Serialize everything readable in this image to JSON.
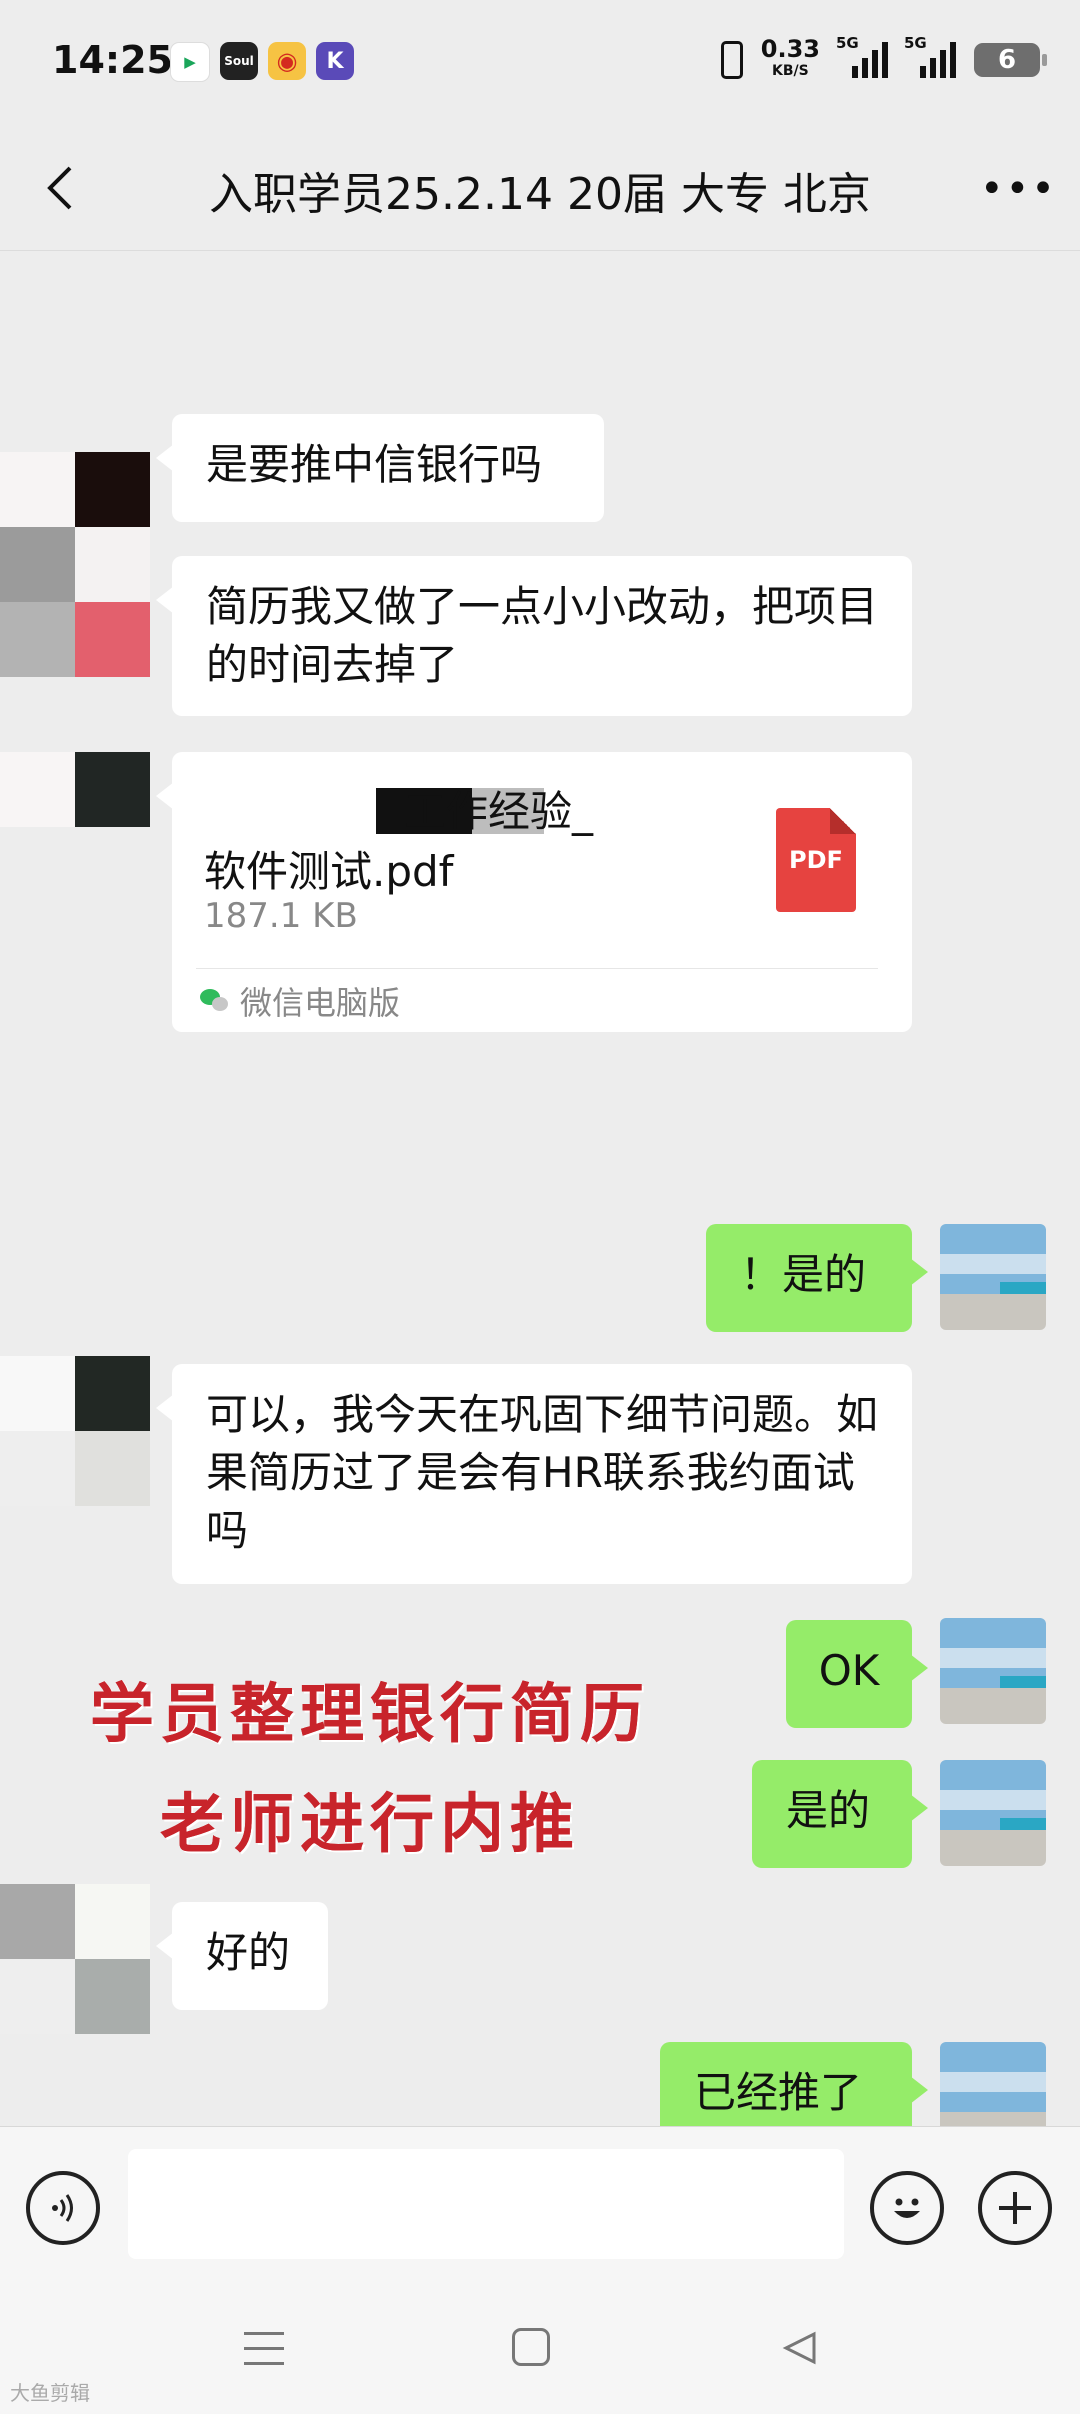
{
  "status_bar": {
    "time": "14:25",
    "app_icons": [
      {
        "name": "video-app-icon",
        "color": "#1aa55a",
        "glyph": "▶"
      },
      {
        "name": "soul-app-icon",
        "color": "#222222",
        "glyph": "Soul"
      },
      {
        "name": "weibo-app-icon",
        "color": "#f6c343",
        "glyph": "◉"
      },
      {
        "name": "k-app-icon",
        "color": "#5a4ab8",
        "glyph": "K"
      }
    ],
    "net_speed": "0.33",
    "net_unit": "KB/S",
    "signal1_label": "5G",
    "signal2_label": "5G",
    "battery": "6"
  },
  "header": {
    "title": "入职学员25.2.14 20届 大专 北京",
    "more": "•••"
  },
  "messages": {
    "m1": "是要推中信银行吗",
    "m2": "简历我又做了一点小小改动，把项目的时间去掉了",
    "file": {
      "name_visible": "工作经验_",
      "name_line2": "软件测试.pdf",
      "size": "187.1 KB",
      "icon_label": "PDF",
      "source": "微信电脑版"
    },
    "m3": "！是的",
    "m4": "可以，我今天在巩固下细节问题。如果简历过了是会有HR联系我约面试吗",
    "m5": "OK",
    "m6": "是的",
    "m7": "好的",
    "m8": "已经推了"
  },
  "overlay": {
    "line1": "学员整理银行简历",
    "line2": "老师进行内推"
  },
  "watermark": "大鱼剪辑",
  "colors": {
    "bubble_out": "#95ec69",
    "bubble_in": "#ffffff",
    "background": "#ededed",
    "overlay_red": "#c8242b",
    "pdf_red": "#e64340"
  }
}
